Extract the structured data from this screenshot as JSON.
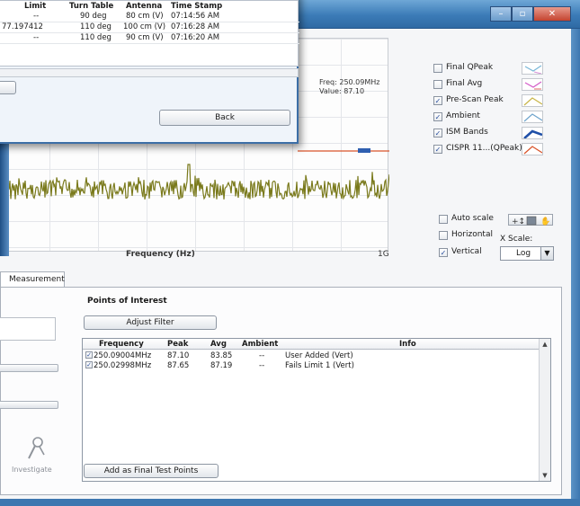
{
  "popup": {
    "table": {
      "columns": [
        "Limit",
        "Turn Table",
        "Antenna",
        "Time Stamp"
      ],
      "rows": [
        {
          "limit": "--",
          "turn_table": "90 deg",
          "antenna": "80 cm (V)",
          "time_stamp": "07:14:56 AM"
        },
        {
          "limit": "77.197412",
          "turn_table": "110 deg",
          "antenna": "100 cm (V)",
          "time_stamp": "07:16:28 AM"
        },
        {
          "limit": "--",
          "turn_table": "110 deg",
          "antenna": "90 cm (V)",
          "time_stamp": "07:16:20 AM"
        }
      ]
    },
    "back_label": "Back"
  },
  "plot": {
    "readout_freq": "Freq: 250.09MHz",
    "readout_value": "Value: 87.10",
    "x_tick": "1G",
    "x_axis_title": "Frequency (Hz)"
  },
  "legend": {
    "items": [
      {
        "label": "Final QPeak",
        "checked": false
      },
      {
        "label": "Final Avg",
        "checked": false
      },
      {
        "label": "Pre-Scan Peak",
        "checked": true
      },
      {
        "label": "Ambient",
        "checked": true
      },
      {
        "label": "ISM Bands",
        "checked": true
      },
      {
        "label": "CISPR 11...(QPeak)",
        "checked": true
      }
    ]
  },
  "scale_options": {
    "auto_scale": "Auto scale",
    "horizontal": "Horizontal",
    "vertical": "Vertical",
    "x_scale_label": "X Scale:",
    "x_scale_value": "Log"
  },
  "tab_label": "Measurement",
  "poi": {
    "title": "Points of Interest",
    "adjust_filter": "Adjust Filter",
    "columns": [
      "Frequency",
      "Peak",
      "Avg",
      "Ambient",
      "Info"
    ],
    "rows": [
      {
        "frequency": "250.09004MHz",
        "peak": "87.10",
        "avg": "83.85",
        "ambient": "--",
        "info": "User Added (Vert)"
      },
      {
        "frequency": "250.02998MHz",
        "peak": "87.65",
        "avg": "87.19",
        "ambient": "--",
        "info": "Fails Limit 1 (Vert)"
      }
    ],
    "add_button": "Add as Final Test Points"
  },
  "investigate_label": "Investigate",
  "colors": {
    "trace": "#7a7a1c",
    "limit_line": "#d9542b",
    "marker": "#2f5fb0",
    "titlebar": "#3b7bb7"
  }
}
